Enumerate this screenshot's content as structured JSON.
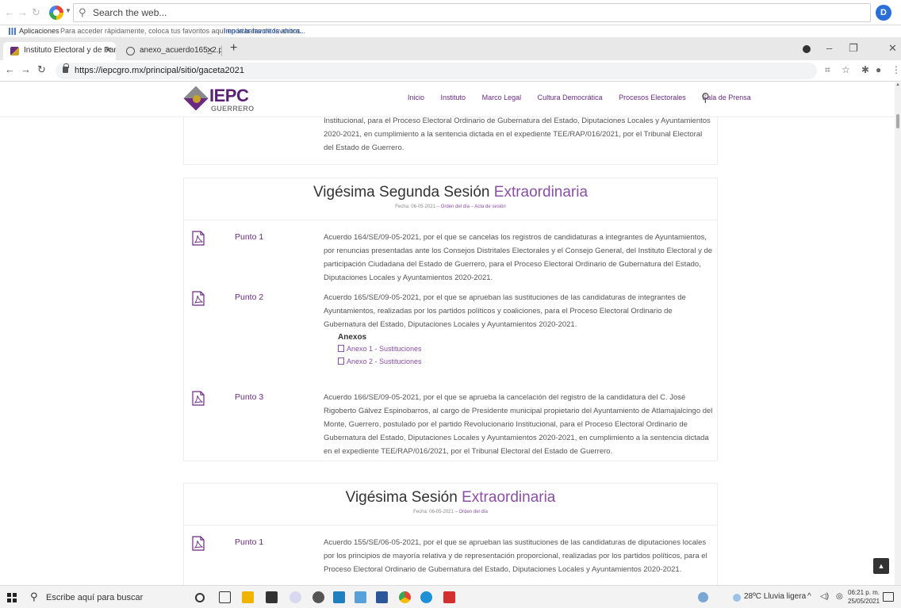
{
  "outer_bar": {
    "search_text": "Search the web..."
  },
  "bookmarks": {
    "apps_label": "Aplicaciones",
    "hint": "Para acceder rápidamente, coloca tus favoritos aquí en la barra de favoritos.",
    "import_link": "Importar favoritos ahora..."
  },
  "tabs": [
    {
      "title": "Instituto Electoral y de Participac",
      "active": true
    },
    {
      "title": "anexo_acuerdo165_2.pdf",
      "active": false
    }
  ],
  "window_controls": {
    "minimize": "–",
    "maximize": "❐",
    "close": "✕"
  },
  "address": {
    "url": "https://iepcgro.mx/principal/sitio/gaceta2021"
  },
  "site": {
    "logo_text": "IEPC",
    "logo_sub": "GUERRERO",
    "nav": [
      "Inicio",
      "Instituto",
      "Marco Legal",
      "Cultura Democrática",
      "Procesos Electorales",
      "Sala de Prensa"
    ]
  },
  "prev_card_text": "Institucional, para el Proceso Electoral Ordinario de Gubernatura del Estado, Diputaciones Locales y Ayuntamientos 2020-2021, en cumplimiento a la sentencia dictada en el expediente TEE/RAP/016/2021, por el Tribunal Electoral del Estado de Guerrero.",
  "sessions": [
    {
      "title_main": "Vigésima Segunda Sesión",
      "title_accent": "Extraordinaria",
      "fecha_label": "Fecha: 06-05-2021",
      "orden": "Orden del día",
      "acta": "Acta de sesión",
      "puntos": [
        {
          "label": "Punto 1",
          "text": "Acuerdo 164/SE/09-05-2021, por el que se cancelas los registros de candidaturas a integrantes de Ayuntamientos, por renuncias presentadas ante los Consejos Distritales Electorales y el Consejo General, del Instituto Electoral y de participación Ciudadana del Estado de Guerrero, para el Proceso Electoral Ordinario de Gubernatura del Estado, Diputaciones Locales y Ayuntamientos 2020-2021."
        },
        {
          "label": "Punto 2",
          "text": "Acuerdo 165/SE/09-05-2021, por el que se aprueban las sustituciones de las candidaturas de integrantes de Ayuntamientos, realizadas por los partidos políticos y coaliciones, para el Proceso Electoral Ordinario de Gubernatura del Estado, Diputaciones Locales y Ayuntamientos 2020-2021.",
          "anexos_title": "Anexos",
          "anexos": [
            "Anexo 1 - Sustituciones",
            "Anexo 2 - Sustituciones"
          ]
        },
        {
          "label": "Punto 3",
          "text": "Acuerdo 166/SE/09-05-2021, por el que se aprueba la cancelación del registro de la candidatura del C. José Rigoberto Gálvez Espinobarros, al cargo de Presidente municipal propietario del Ayuntamiento de Atlamajalcingo del Monte, Guerrero, postulado por el partido Revolucionario Institucional, para el Proceso Electoral Ordinario de Gubernatura del Estado, Diputaciones Locales y Ayuntamientos 2020-2021, en cumplimiento a la sentencia dictada en el expediente TEE/RAP/016/2021, por el Tribunal Electoral del Estado de Guerrero."
        }
      ]
    },
    {
      "title_main": "Vigésima Sesión",
      "title_accent": "Extraordinaria",
      "fecha_label": "Fecha: 06-05-2021",
      "orden": "Orden del día",
      "puntos": [
        {
          "label": "Punto 1",
          "text": "Acuerdo 155/SE/06-05-2021, por el que se aprueban las sustituciones de las candidaturas de diputaciones locales por los principios de mayoría relativa y de representación proporcional, realizadas por los partidos políticos, para el Proceso Electoral Ordinario de Gubernatura del Estado, Diputaciones Locales y Ayuntamientos 2020-2021."
        }
      ]
    }
  ],
  "taskbar": {
    "search_placeholder": "Escribe aquí para buscar",
    "weather": "28ºC  Lluvia ligera",
    "time": "06:21 p. m.",
    "date": "25/05/2021"
  },
  "colors": {
    "brand_purple": "#6a2a82",
    "accent_purple": "#8a4fa6",
    "brand_gold": "#c9a227"
  }
}
